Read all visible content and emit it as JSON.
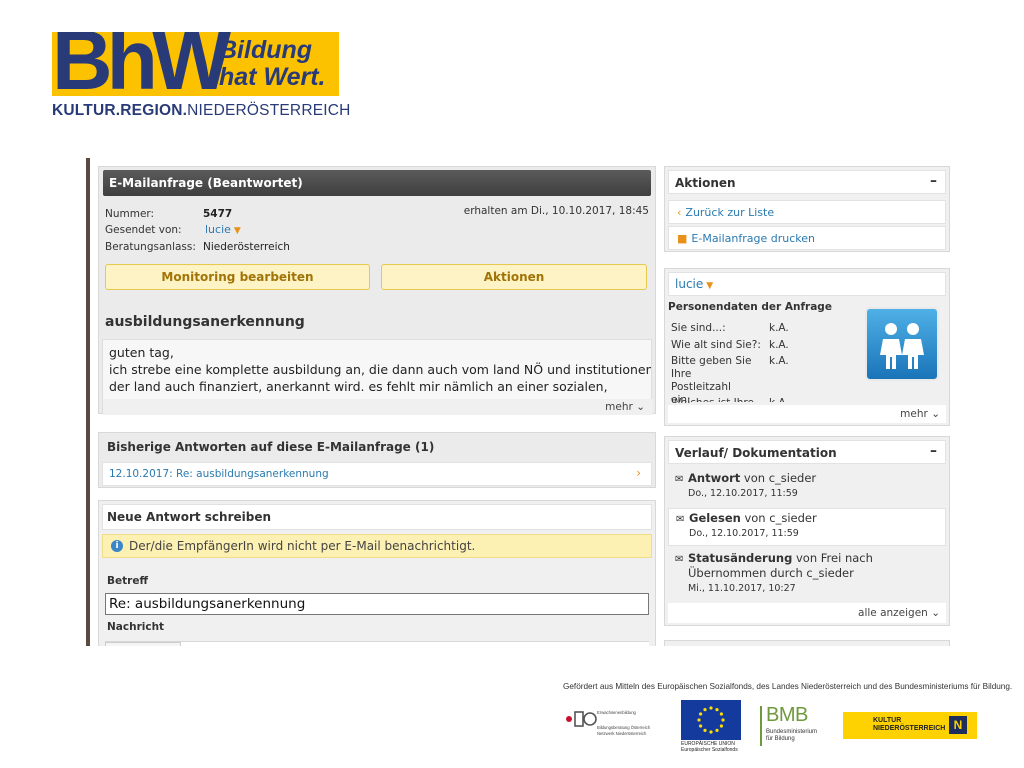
{
  "brand": {
    "logo_letters": "BhW",
    "tagline_line1": "Bildung",
    "tagline_line2": "hat Wert.",
    "region_part1": "KULTUR",
    "region_part2": "REGION",
    "region_part3": "NIEDERÖSTERREICH",
    "logo_bg_color": "#fcc200",
    "logo_fg_color": "#283a78"
  },
  "mail": {
    "header": "E-Mailanfrage (Beantwortet)",
    "nummer_label": "Nummer:",
    "nummer_value": "5477",
    "sender_label": "Gesendet von:",
    "sender_value": "lucie",
    "reason_label": "Beratungsanlass:",
    "reason_value": "Niederösterreich",
    "received": "erhalten am Di., 10.10.2017, 18:45",
    "monitoring_button": "Monitoring bearbeiten",
    "actions_button": "Aktionen",
    "subject": "ausbildungsanerkennung",
    "body_lines": [
      "guten tag,",
      "ich strebe eine komplette ausbildung an, die dann auch vom land NÖ und institutionen die",
      "der land auch finanziert, anerkannt wird. es fehlt mir nämlich an einer sozialen,"
    ],
    "more_label": "mehr"
  },
  "previous": {
    "title": "Bisherige Antworten auf diese E-Mailanfrage (1)",
    "items": [
      {
        "label": "12.10.2017: Re: ausbildungsanerkennung"
      }
    ]
  },
  "new_answer": {
    "title": "Neue Antwort schreiben",
    "notice": "Der/die EmpfängerIn wird nicht per E-Mail benachrichtigt.",
    "subject_label": "Betreff",
    "subject_value": "Re: ausbildungsanerkennung",
    "message_label": "Nachricht"
  },
  "actions": {
    "title": "Aktionen",
    "collapse": "–",
    "back": "Zurück zur Liste",
    "print": "E-Mailanfrage drucken"
  },
  "person": {
    "name": "lucie",
    "section_title": "Personendaten der Anfrage",
    "fields": [
      {
        "label": "Sie sind...:",
        "value": "k.A."
      },
      {
        "label": "Wie alt sind Sie?:",
        "value": "k.A."
      },
      {
        "label": "Bitte geben Sie Ihre Postleitzahl ein:",
        "value": "k.A."
      },
      {
        "label": "Welches ist Ihre",
        "value": "k.A."
      }
    ],
    "more_label": "mehr"
  },
  "history": {
    "title": "Verlauf/ Dokumentation",
    "collapse": "–",
    "items": [
      {
        "event": "Antwort",
        "text": " von c_sieder",
        "date": "Do., 12.10.2017, 11:59"
      },
      {
        "event": "Gelesen",
        "text": " von c_sieder",
        "date": "Do., 12.10.2017, 11:59"
      },
      {
        "event": "Statusänderung",
        "text": " von Frei nach Übernommen durch c_sieder",
        "date": "Mi., 11.10.2017, 10:27"
      }
    ],
    "show_all": "alle anzeigen"
  },
  "footer": {
    "funding_text": "Gefördert aus Mitteln des Europäischen Sozialfonds, des Landes Niederösterreich und des Bundesministeriums für Bildung.",
    "eb_line1": "Erwachsenenbildung",
    "eb_line2": "Bildungsberatung Österreich",
    "eb_line3": "Netzwerk Niederösterreich",
    "eu_line1": "EUROPÄISCHE UNION",
    "eu_line2": "Europäischer Sozialfonds",
    "bmb_abbr": "BMB",
    "bmb_line1": "Bundesministerium",
    "bmb_line2": "für Bildung",
    "kn_line1": "KULTUR",
    "kn_line2": "NIEDERÖSTERREICH",
    "kn_mark": "N"
  }
}
